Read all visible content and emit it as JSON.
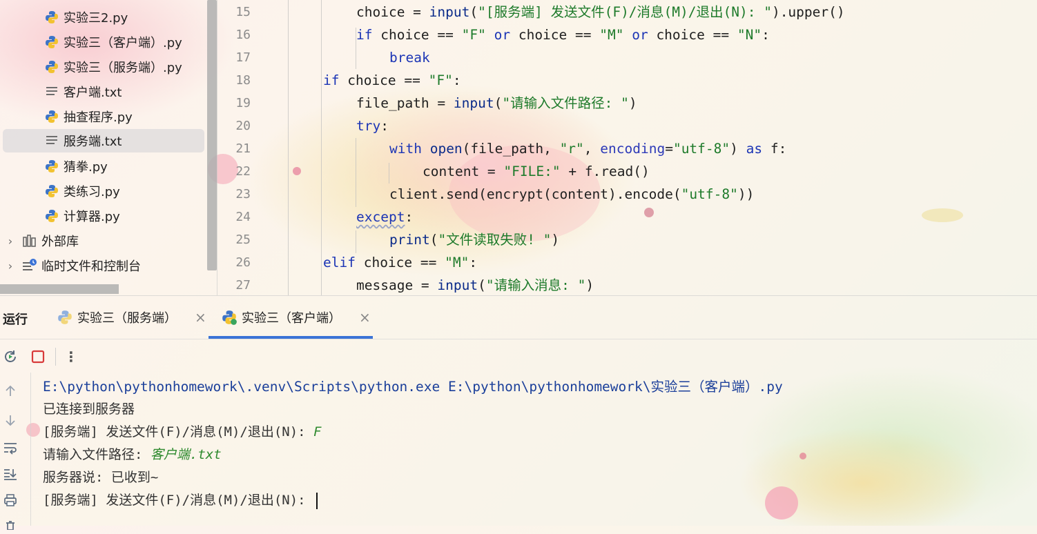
{
  "colors": {
    "accent": "#3b73d6",
    "keyword": "#1c35b5",
    "string": "#1d7a2a",
    "console_command": "#1b3f9a",
    "console_input": "#2e8a2e"
  },
  "project_tree": {
    "files": [
      {
        "name": "实验三2.py",
        "icon": "python-file-icon"
      },
      {
        "name": "实验三（客户端）.py",
        "icon": "python-file-icon"
      },
      {
        "name": "实验三（服务端）.py",
        "icon": "python-file-icon"
      },
      {
        "name": "客户端.txt",
        "icon": "text-file-icon"
      },
      {
        "name": "抽查程序.py",
        "icon": "python-file-icon"
      },
      {
        "name": "服务端.txt",
        "icon": "text-file-icon",
        "selected": true
      },
      {
        "name": "猜拳.py",
        "icon": "python-file-icon"
      },
      {
        "name": "类练习.py",
        "icon": "python-file-icon"
      },
      {
        "name": "计算器.py",
        "icon": "python-file-icon"
      }
    ],
    "external_libraries": "外部库",
    "scratches": "临时文件和控制台"
  },
  "editor": {
    "line_numbers": [
      "15",
      "16",
      "17",
      "18",
      "19",
      "20",
      "21",
      "22",
      "23",
      "24",
      "25",
      "26",
      "27"
    ],
    "lines": {
      "l15": {
        "a": "choice = ",
        "b": "input",
        "c": "(",
        "d": "\"[服务端] 发送文件(F)/消息(M)/退出(N): \"",
        "e": ").upper()"
      },
      "l16": {
        "a": "if",
        "b": " choice == ",
        "c": "\"F\"",
        "d": " or",
        "e": " choice == ",
        "f": "\"M\"",
        "g": " or",
        "h": " choice == ",
        "i": "\"N\"",
        "j": ":"
      },
      "l17": {
        "a": "break"
      },
      "l18": {
        "a": "if",
        "b": " choice == ",
        "c": "\"F\"",
        "d": ":"
      },
      "l19": {
        "a": "file_path = ",
        "b": "input",
        "c": "(",
        "d": "\"请输入文件路径: \"",
        "e": ")"
      },
      "l20": {
        "a": "try",
        "b": ":"
      },
      "l21": {
        "a": "with",
        "b": " open",
        "c": "(file_path, ",
        "d": "\"r\"",
        "e": ", ",
        "f": "encoding",
        "g": "=",
        "h": "\"utf-8\"",
        "i": ") ",
        "j": "as",
        "k": " f:"
      },
      "l22": {
        "a": "content = ",
        "b": "\"FILE:\"",
        "c": " + f.read()"
      },
      "l23": {
        "a": "client.send(encrypt(content).encode(",
        "b": "\"utf-8\"",
        "c": "))"
      },
      "l24": {
        "a": "except",
        "b": ":"
      },
      "l25": {
        "a": "print",
        "b": "(",
        "c": "\"文件读取失败! \"",
        "d": ")"
      },
      "l26": {
        "a": "elif",
        "b": " choice == ",
        "c": "\"M\"",
        "d": ":"
      },
      "l27": {
        "a": "message = ",
        "b": "input",
        "c": "(",
        "d": "\"请输入消息: \"",
        "e": ")"
      }
    }
  },
  "run": {
    "title": "运行",
    "tabs": [
      {
        "label": "实验三（服务端）",
        "active": false
      },
      {
        "label": "实验三（客户端）",
        "active": true
      }
    ],
    "console": {
      "command": "E:\\python\\pythonhomework\\.venv\\Scripts\\python.exe E:\\python\\pythonhomework\\实验三（客户端）.py",
      "line2": "已连接到服务器",
      "line3_prompt": "[服务端] 发送文件(F)/消息(M)/退出(N): ",
      "line3_input": "F",
      "line4_prompt": "请输入文件路径: ",
      "line4_input": "客户端.txt",
      "line5": "服务器说: 已收到~",
      "line6_prompt": "[服务端] 发送文件(F)/消息(M)/退出(N): "
    }
  }
}
